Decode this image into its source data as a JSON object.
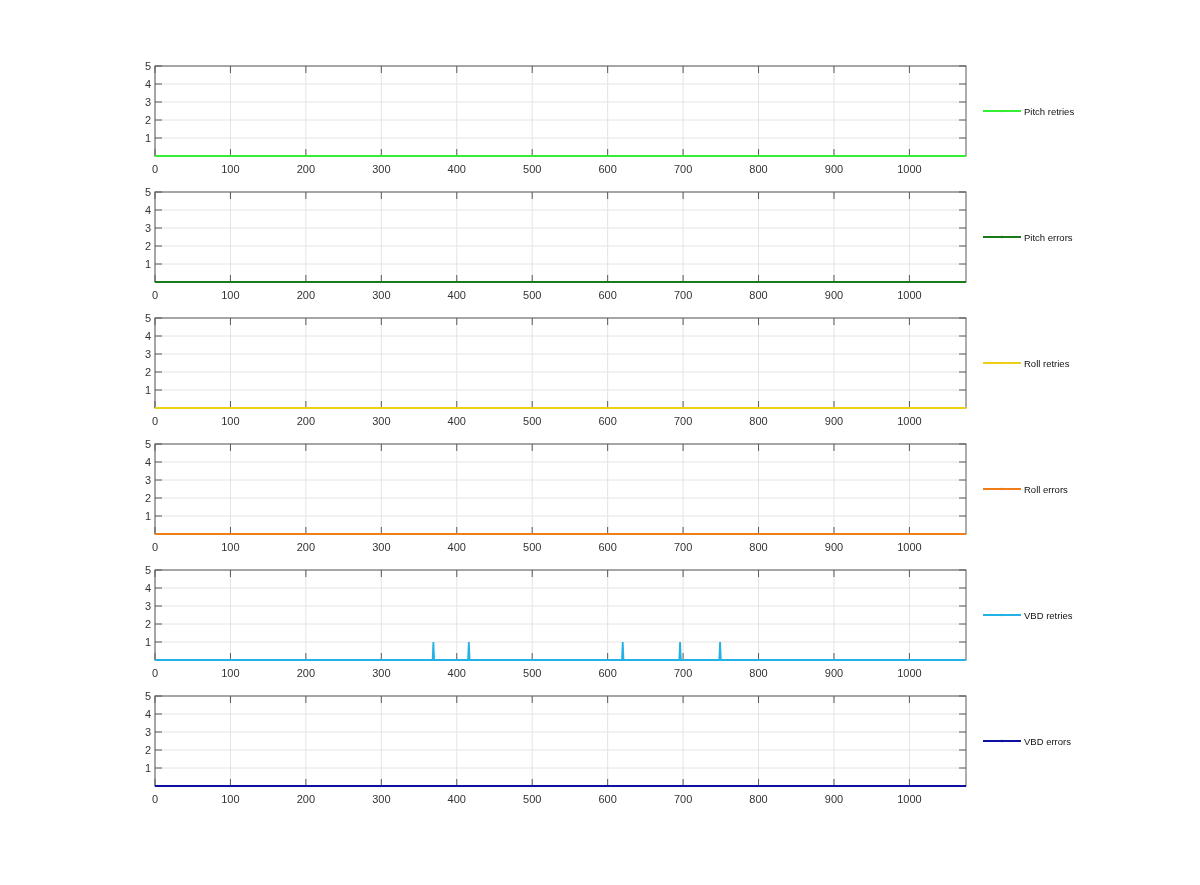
{
  "charts": [
    {
      "chart_data": {
        "type": "line",
        "xlim": [
          0,
          1075
        ],
        "ylim": [
          0,
          5
        ],
        "xticks": [
          0,
          100,
          200,
          300,
          400,
          500,
          600,
          700,
          800,
          900,
          1000
        ],
        "yticks": [
          1,
          2,
          3,
          4,
          5
        ],
        "grid": true,
        "series": [
          {
            "name": "Pitch retries",
            "color": "#33ee33",
            "x": [
              0,
              1075
            ],
            "values": [
              0,
              0
            ]
          }
        ]
      }
    },
    {
      "chart_data": {
        "type": "line",
        "xlim": [
          0,
          1075
        ],
        "ylim": [
          0,
          5
        ],
        "xticks": [
          0,
          100,
          200,
          300,
          400,
          500,
          600,
          700,
          800,
          900,
          1000
        ],
        "yticks": [
          1,
          2,
          3,
          4,
          5
        ],
        "grid": true,
        "series": [
          {
            "name": "Pitch errors",
            "color": "#1a7a1a",
            "x": [
              0,
              1075
            ],
            "values": [
              0,
              0
            ]
          }
        ]
      }
    },
    {
      "chart_data": {
        "type": "line",
        "xlim": [
          0,
          1075
        ],
        "ylim": [
          0,
          5
        ],
        "xticks": [
          0,
          100,
          200,
          300,
          400,
          500,
          600,
          700,
          800,
          900,
          1000
        ],
        "yticks": [
          1,
          2,
          3,
          4,
          5
        ],
        "grid": true,
        "series": [
          {
            "name": "Roll retries",
            "color": "#edd015",
            "x": [
              0,
              1075
            ],
            "values": [
              0,
              0
            ]
          }
        ]
      }
    },
    {
      "chart_data": {
        "type": "line",
        "xlim": [
          0,
          1075
        ],
        "ylim": [
          0,
          5
        ],
        "xticks": [
          0,
          100,
          200,
          300,
          400,
          500,
          600,
          700,
          800,
          900,
          1000
        ],
        "yticks": [
          1,
          2,
          3,
          4,
          5
        ],
        "grid": true,
        "series": [
          {
            "name": "Roll errors",
            "color": "#ee7d1a",
            "x": [
              0,
              1075
            ],
            "values": [
              0,
              0
            ]
          }
        ]
      }
    },
    {
      "chart_data": {
        "type": "line",
        "xlim": [
          0,
          1075
        ],
        "ylim": [
          0,
          5
        ],
        "xticks": [
          0,
          100,
          200,
          300,
          400,
          500,
          600,
          700,
          800,
          900,
          1000
        ],
        "yticks": [
          1,
          2,
          3,
          4,
          5
        ],
        "grid": true,
        "series": [
          {
            "name": "VBD retries",
            "color": "#23b1e6",
            "x": [
              0,
              368,
              369,
              370,
              415,
              416,
              417,
              619,
              620,
              621,
              695,
              696,
              697,
              748,
              749,
              750,
              1075
            ],
            "values": [
              0,
              0,
              1,
              0,
              0,
              1,
              0,
              0,
              1,
              0,
              0,
              1,
              0,
              0,
              1,
              0,
              0
            ]
          }
        ]
      }
    },
    {
      "chart_data": {
        "type": "line",
        "xlim": [
          0,
          1075
        ],
        "ylim": [
          0,
          5
        ],
        "xticks": [
          0,
          100,
          200,
          300,
          400,
          500,
          600,
          700,
          800,
          900,
          1000
        ],
        "yticks": [
          1,
          2,
          3,
          4,
          5
        ],
        "grid": true,
        "series": [
          {
            "name": "VBD errors",
            "color": "#1010a0",
            "x": [
              0,
              1075
            ],
            "values": [
              0,
              0
            ]
          }
        ]
      }
    }
  ]
}
